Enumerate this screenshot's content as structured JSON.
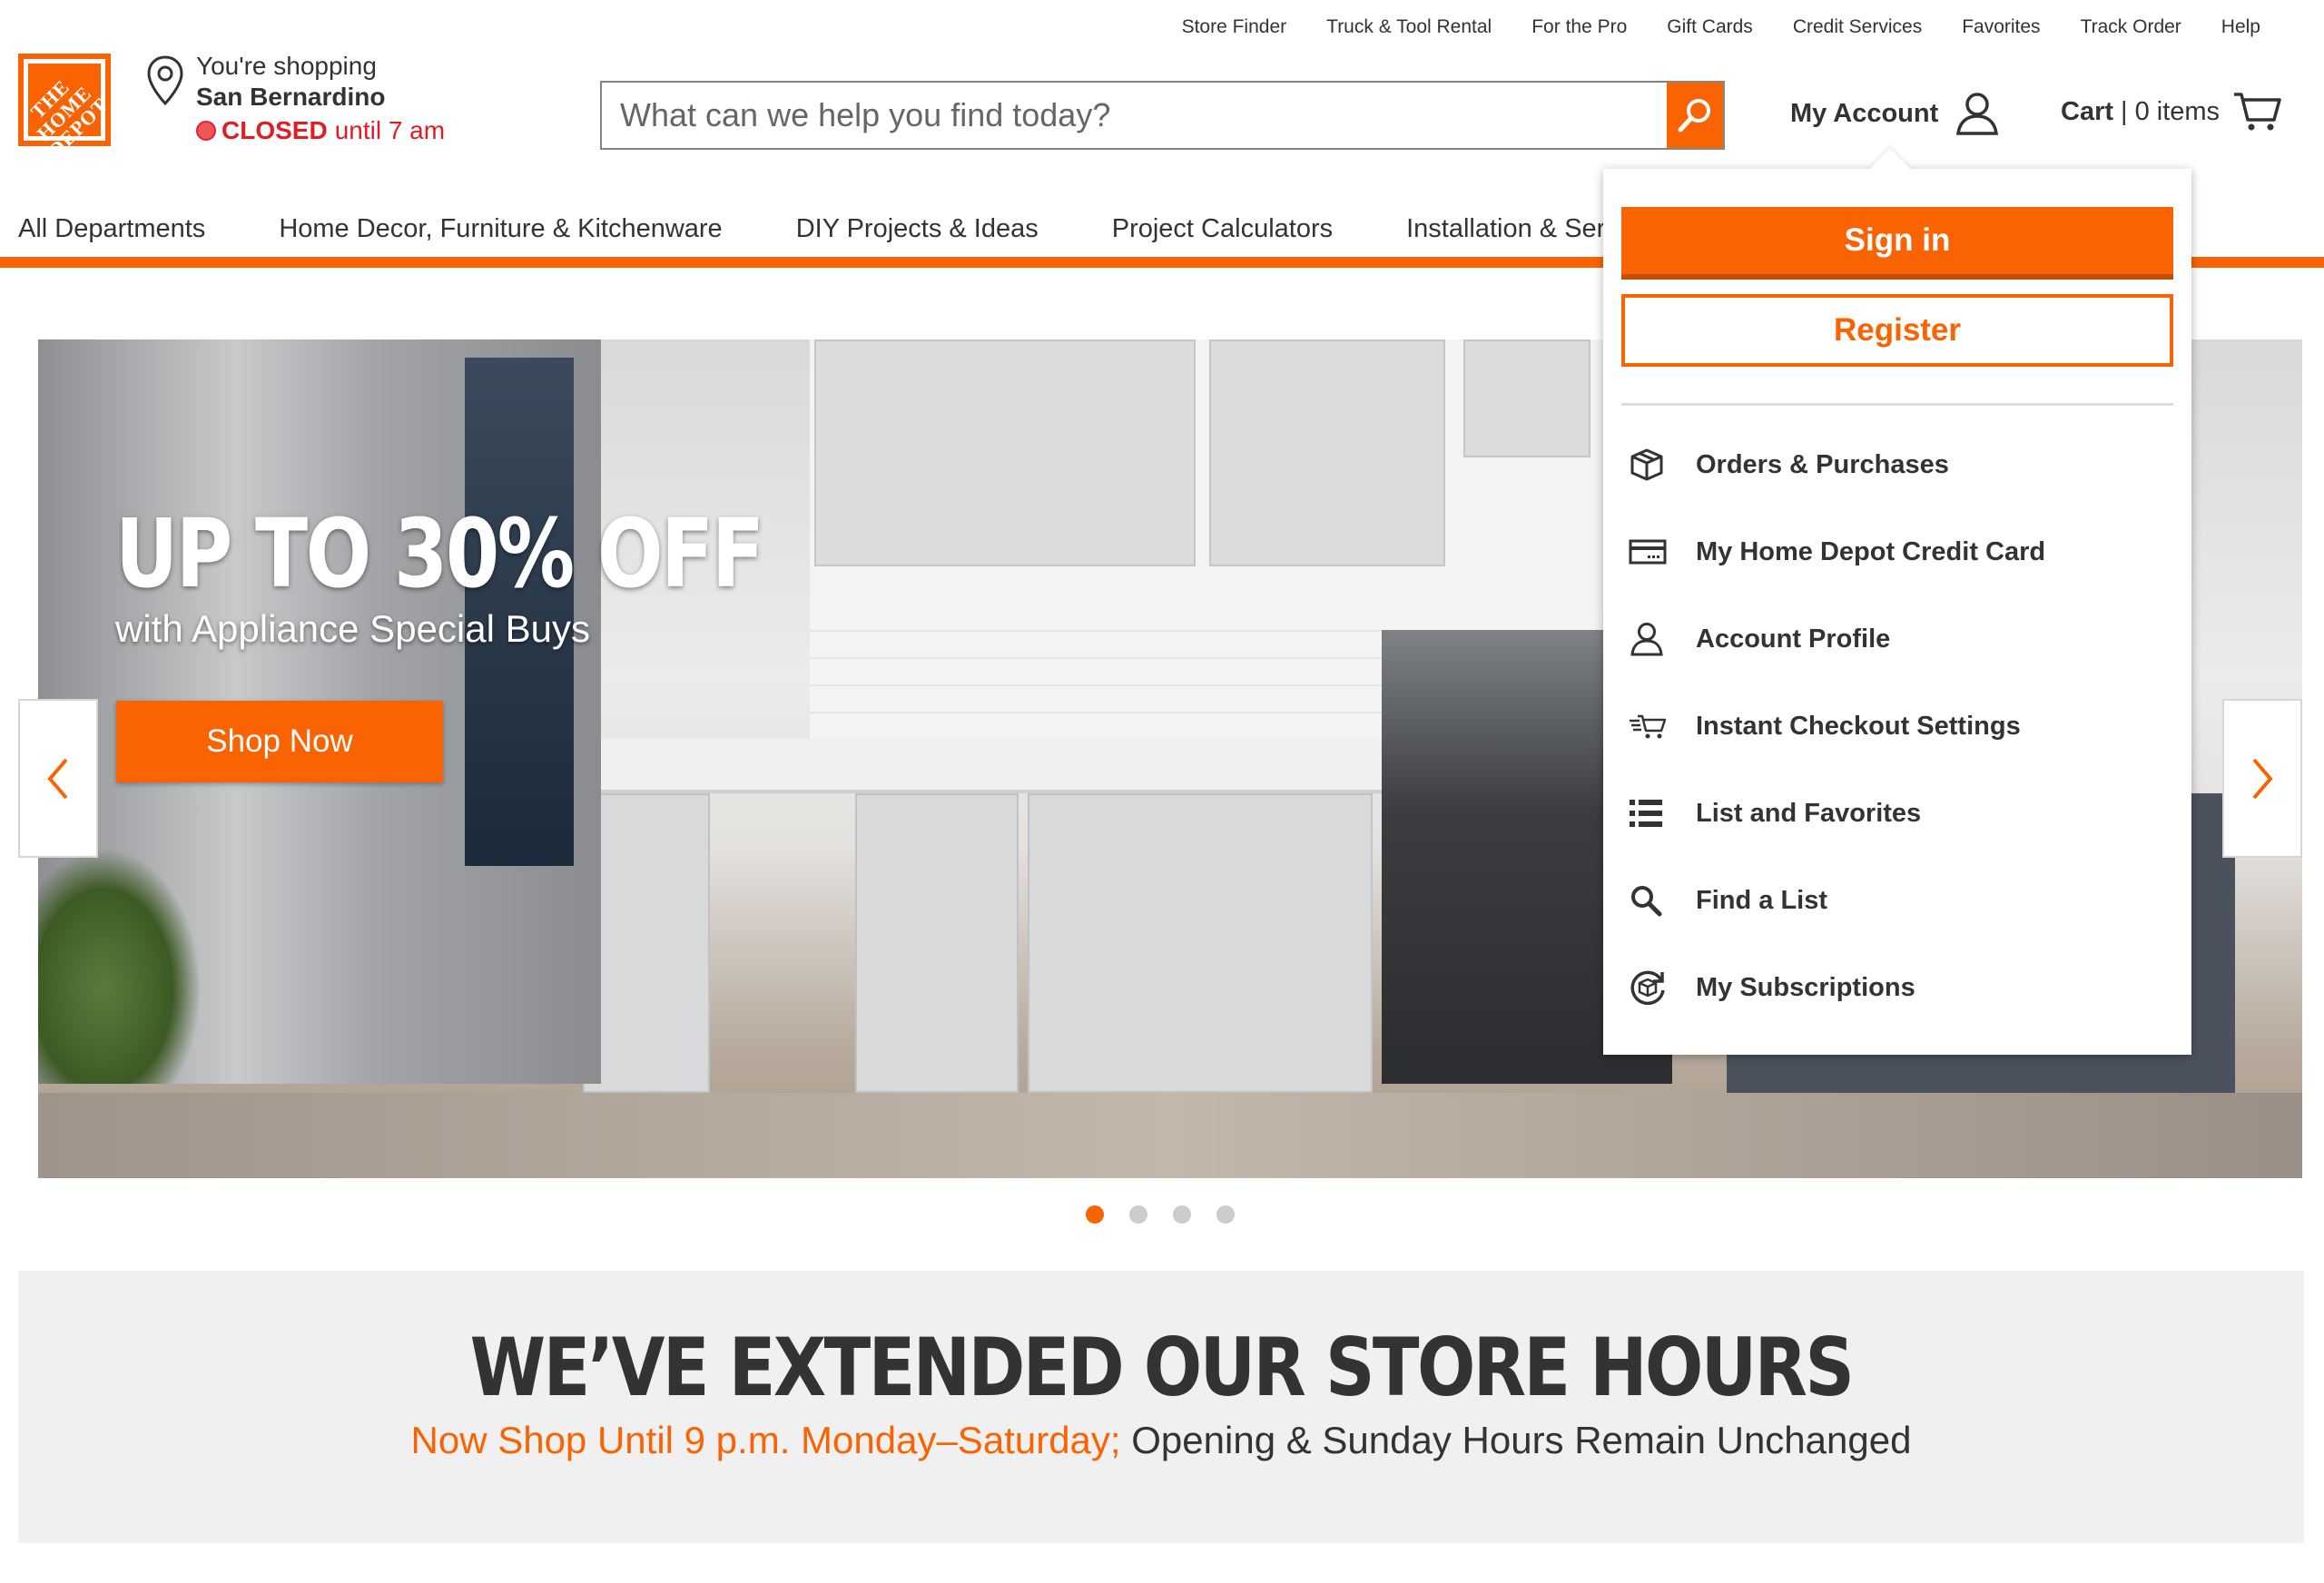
{
  "utility_nav": [
    "Store Finder",
    "Truck & Tool Rental",
    "For the Pro",
    "Gift Cards",
    "Credit Services",
    "Favorites",
    "Track Order",
    "Help"
  ],
  "logo_text": "THE HOME DEPOT",
  "store": {
    "line1": "You're shopping",
    "name": "San Bernardino",
    "status": "CLOSED",
    "status_detail": "until 7 am"
  },
  "search": {
    "placeholder": "What can we help you find today?"
  },
  "account": {
    "label": "My Account"
  },
  "cart": {
    "label": "Cart",
    "separator": "|",
    "count": "0 items"
  },
  "main_nav": [
    "All Departments",
    "Home Decor, Furniture & Kitchenware",
    "DIY Projects & Ideas",
    "Project Calculators",
    "Installation & Servic"
  ],
  "hero": {
    "headline": "UP TO 30% OFF",
    "subhead": "with Appliance Special Buys",
    "cta": "Shop Now",
    "slide_count": 4,
    "active_slide": 1
  },
  "hours_banner": {
    "headline": "WE’VE EXTENDED OUR STORE HOURS",
    "sub_highlight": "Now Shop Until 9 p.m. Monday–Saturday;",
    "sub_rest": " Opening & Sunday Hours Remain Unchanged"
  },
  "account_menu": {
    "signin": "Sign in",
    "register": "Register",
    "items": [
      {
        "label": "Orders & Purchases",
        "icon": "box-icon"
      },
      {
        "label": "My Home Depot Credit Card",
        "icon": "credit-card-icon"
      },
      {
        "label": "Account Profile",
        "icon": "user-icon"
      },
      {
        "label": "Instant Checkout Settings",
        "icon": "fast-cart-icon"
      },
      {
        "label": "List and Favorites",
        "icon": "list-icon"
      },
      {
        "label": "Find a List",
        "icon": "search-icon"
      },
      {
        "label": "My Subscriptions",
        "icon": "subscription-icon"
      }
    ]
  },
  "colors": {
    "brand_orange": "#f96302",
    "closed_red": "#e31b23",
    "text": "#333333"
  }
}
